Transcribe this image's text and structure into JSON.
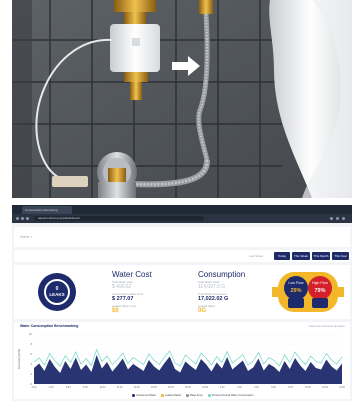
{
  "browser": {
    "tab_title": "Consumption Monitoring",
    "url": "aquamonitoring.app/dashboard"
  },
  "dashboard": {
    "breadcrumb": "Home  >",
    "date_range": "Last Week",
    "filters": [
      "Today",
      "This Week",
      "This Month",
      "This Year"
    ],
    "leaks": {
      "count": "0",
      "label": "LEAKS"
    },
    "water_cost": {
      "title": "Water Cost",
      "total_label": "Total Water Cost",
      "total_value": "$ 490.62",
      "period_label": "Consumption Water Cost",
      "period_value": "$ 277.07",
      "leak_label": "Leaked Water Cost",
      "leak_value": "$0"
    },
    "consumption": {
      "title": "Consumption",
      "total_label": "Total Water Used",
      "total_value": "114,097.5 G",
      "period_label": "Total Water Consumed",
      "period_value": "17,022.02 G",
      "leak_label": "Leaked Water",
      "leak_value": "0G"
    },
    "gauge": {
      "low_label": "Low Flow",
      "low_value": "29%",
      "high_label": "High Flow",
      "high_value": "79%",
      "colors": {
        "body": "#f3b82a",
        "left": "#1d2a6b",
        "right": "#d3202a"
      }
    },
    "chart_card": {
      "title": "Water Consumption Benchmarking",
      "note": "Select all / Remove all series"
    }
  },
  "chart_data": {
    "type": "area",
    "ylabel": "Flow Rate (GPM)",
    "ylim": [
      0,
      10
    ],
    "yticks": [
      "10",
      "8",
      "6",
      "4",
      "2",
      "0"
    ],
    "series": [
      {
        "name": "Consumed Water",
        "color": "#1d2a6b",
        "values": [
          3.2,
          4.1,
          2.6,
          5.0,
          3.4,
          2.2,
          4.6,
          3.0,
          5.3,
          2.8,
          3.9,
          2.4,
          5.8,
          3.1,
          4.4,
          2.5,
          3.7,
          5.1,
          2.9,
          4.0,
          3.3,
          2.6,
          4.8,
          3.5,
          2.7,
          4.2,
          5.5,
          3.0,
          2.3,
          4.5,
          3.6,
          2.8,
          5.0,
          3.9,
          2.5,
          4.3,
          3.1,
          5.4,
          2.9,
          3.8,
          4.7,
          2.6,
          3.3,
          5.1,
          2.7,
          4.0,
          3.4,
          2.4,
          4.6,
          3.0,
          5.2,
          3.7,
          2.6,
          4.4,
          3.2,
          2.9,
          4.9,
          3.5,
          2.7,
          4.1
        ]
      },
      {
        "name": "Leaked Water",
        "color": "#f3b82a",
        "values": [
          0,
          0,
          0,
          0,
          0,
          0,
          0,
          0,
          0,
          0,
          0,
          0,
          0,
          0,
          0,
          0,
          0,
          0,
          0,
          0,
          0,
          0,
          0,
          0,
          0,
          0,
          0,
          0,
          0,
          0,
          0,
          0,
          0,
          0,
          0,
          0,
          0,
          0,
          0,
          0,
          0,
          0,
          0,
          0,
          0,
          0,
          0,
          0,
          0,
          0,
          0,
          0,
          0,
          0,
          0,
          0,
          0,
          0,
          0,
          0
        ]
      },
      {
        "name": "Base Zone",
        "color": "#8d8d8d",
        "values": [
          0,
          0,
          0,
          0,
          0,
          0,
          0,
          0,
          0,
          0,
          0,
          0,
          0,
          0,
          0,
          0,
          0,
          0,
          0,
          0,
          0,
          0,
          0,
          0,
          0,
          0,
          0,
          0,
          0,
          0,
          0,
          0,
          0,
          0,
          0,
          0,
          0,
          0,
          0,
          0,
          0,
          0,
          0,
          0,
          0,
          0,
          0,
          0,
          0,
          0,
          0,
          0,
          0,
          0,
          0,
          0,
          0,
          0,
          0,
          0
        ]
      },
      {
        "name": "Previous Period Water Consumption",
        "color": "#6fd6c8",
        "values": [
          4.4,
          5.2,
          3.8,
          6.1,
          4.6,
          3.6,
          5.7,
          4.3,
          6.4,
          4.0,
          5.1,
          3.7,
          6.9,
          4.5,
          5.6,
          3.9,
          4.9,
          6.2,
          4.1,
          5.3,
          4.6,
          3.9,
          6.0,
          4.8,
          3.9,
          5.4,
          6.6,
          4.2,
          3.6,
          5.8,
          4.9,
          4.0,
          6.2,
          5.1,
          3.8,
          5.5,
          4.3,
          6.5,
          4.2,
          5.0,
          5.9,
          3.8,
          4.6,
          6.3,
          4.0,
          5.3,
          4.7,
          3.6,
          5.8,
          4.3,
          6.4,
          5.0,
          3.9,
          5.6,
          4.5,
          4.2,
          6.1,
          4.8,
          4.0,
          5.4
        ]
      }
    ],
    "xticks": [
      "2:00",
      "4:00",
      "6:00",
      "8:00",
      "10:00",
      "12:00",
      "14:00",
      "16:00",
      "18:00",
      "20:00",
      "22:00",
      "0:00",
      "2:00",
      "4:00",
      "6:00",
      "8:00",
      "10:00",
      "12:00",
      "14:00"
    ]
  }
}
